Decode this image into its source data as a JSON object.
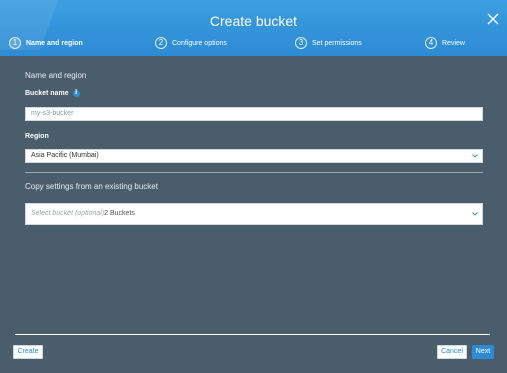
{
  "header": {
    "title": "Create bucket",
    "close_icon": "close-icon"
  },
  "steps": [
    {
      "number": "1",
      "label": "Name and region",
      "active": true
    },
    {
      "number": "2",
      "label": "Configure options",
      "active": false
    },
    {
      "number": "3",
      "label": "Set permissions",
      "active": false
    },
    {
      "number": "4",
      "label": "Review",
      "active": false
    }
  ],
  "form": {
    "section_title": "Name and region",
    "bucket_name": {
      "label": "Bucket name",
      "value": "my-s3-bucker",
      "info_icon": "info-icon"
    },
    "region": {
      "label": "Region",
      "value": "Asia Pacific (Mumbai)"
    },
    "copy_settings": {
      "title": "Copy settings from an existing bucket",
      "placeholder": "Select bucket (optional)",
      "count": "2 Buckets"
    }
  },
  "footer": {
    "create_label": "Create",
    "cancel_label": "Cancel",
    "next_label": "Next"
  },
  "colors": {
    "header": "#2c8bd4",
    "body": "#4a5d6b",
    "accent": "#2c8bd4"
  }
}
